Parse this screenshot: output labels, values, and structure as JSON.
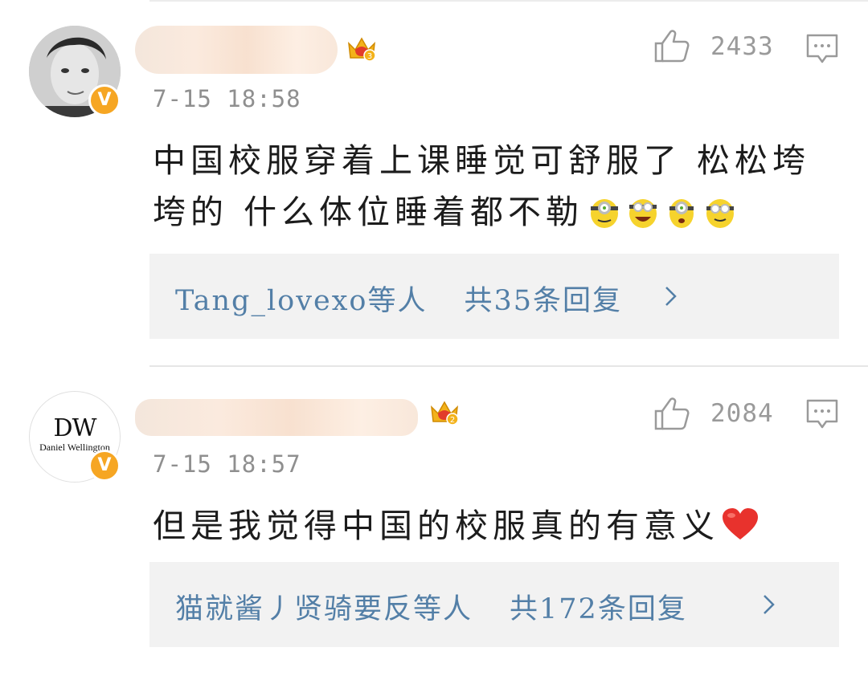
{
  "comments": [
    {
      "timestamp": "7-15  18:58",
      "likes": "2433",
      "text": "中国校服穿着上课睡觉可舒服了 松松垮垮的 什么体位睡着都不勒",
      "crown_level": "3",
      "replies": {
        "names": "Tang_lovexo等人",
        "count_text": "共35条回复"
      }
    },
    {
      "timestamp": "7-15  18:57",
      "likes": "2084",
      "text": "但是我觉得中国的校服真的有意义",
      "crown_level": "2",
      "avatar_brand": {
        "mark": "DW",
        "name": "Daniel Wellington"
      },
      "replies": {
        "names": "猫就酱丿贤骑要反等人",
        "count_text": "共172条回复"
      }
    }
  ],
  "icons": {
    "like": "thumbs-up-icon",
    "reply": "comment-bubble-icon",
    "verified": "verified-v-icon",
    "crown": "crown-badge-icon",
    "chevron": "chevron-right-icon"
  },
  "colors": {
    "link": "#537fa7",
    "verified": "#f6a623",
    "muted": "#9a9a9a",
    "reply_bg": "#f2f2f2"
  }
}
